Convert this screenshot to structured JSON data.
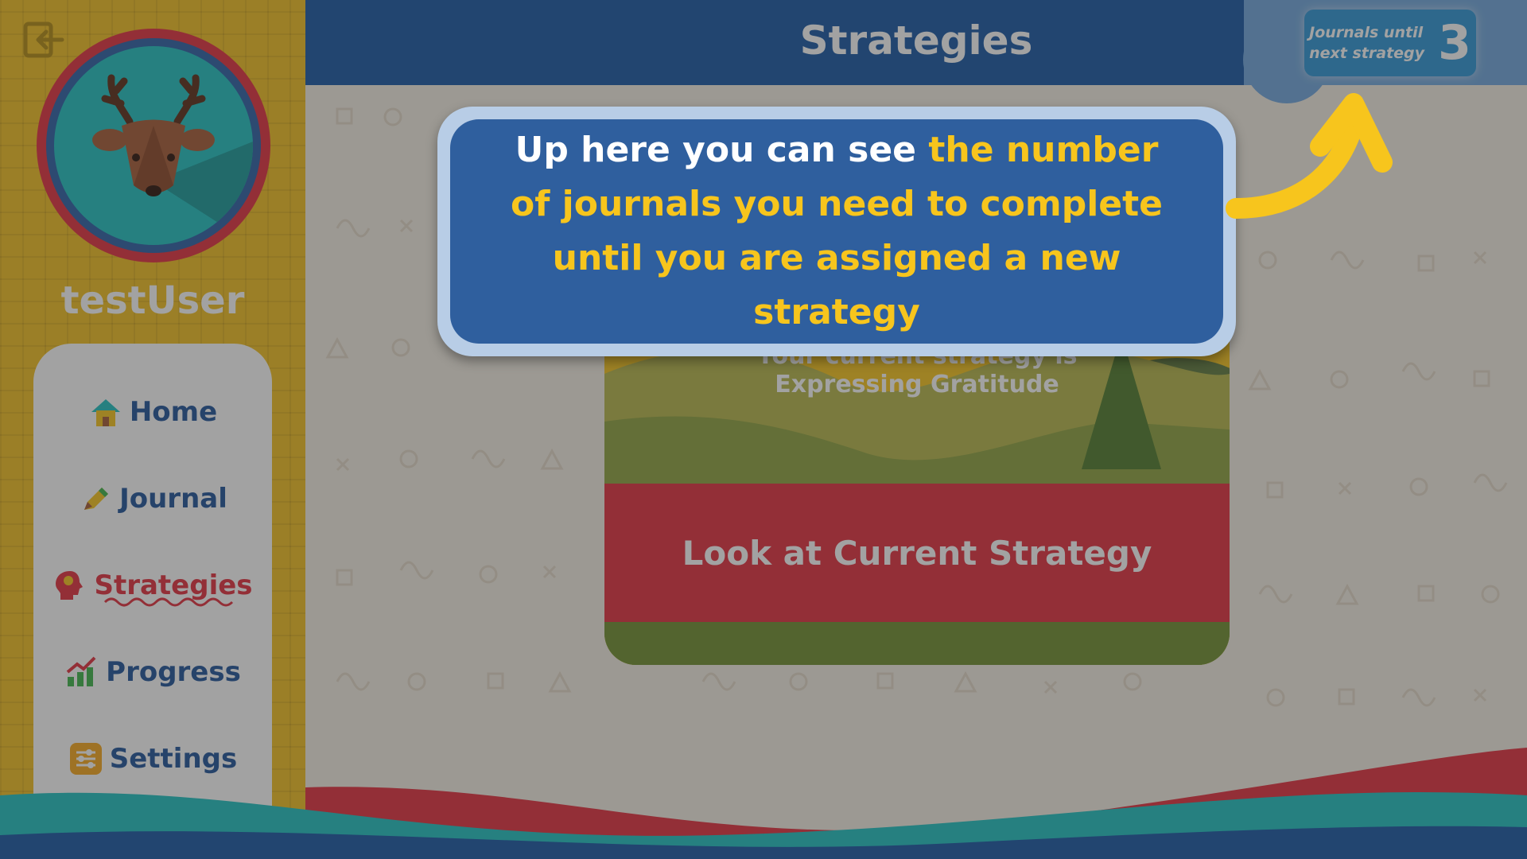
{
  "header": {
    "title": "Strategies",
    "counter_label_line1": "Journals until",
    "counter_label_line2": "next strategy",
    "counter_value": "3"
  },
  "sidebar": {
    "username": "testUser",
    "items": [
      {
        "label": "Home",
        "icon": "house-icon",
        "active": false
      },
      {
        "label": "Journal",
        "icon": "pencil-icon",
        "active": false
      },
      {
        "label": "Strategies",
        "icon": "head-icon",
        "active": true
      },
      {
        "label": "Progress",
        "icon": "chart-icon",
        "active": false
      },
      {
        "label": "Settings",
        "icon": "sliders-icon",
        "active": false
      }
    ]
  },
  "card": {
    "line1": "Your current strategy is",
    "line2": "Expressing Gratitude",
    "button_label": "Look at Current Strategy"
  },
  "tutorial": {
    "text_plain": "Up here you can see",
    "text_highlight": "the number of journals you need to complete until you are assigned a new strategy"
  },
  "colors": {
    "header_blue": "#1657a5",
    "accent_yellow": "#f7c51d",
    "accent_red": "#e42f3d",
    "nav_blue": "#1e5299"
  }
}
